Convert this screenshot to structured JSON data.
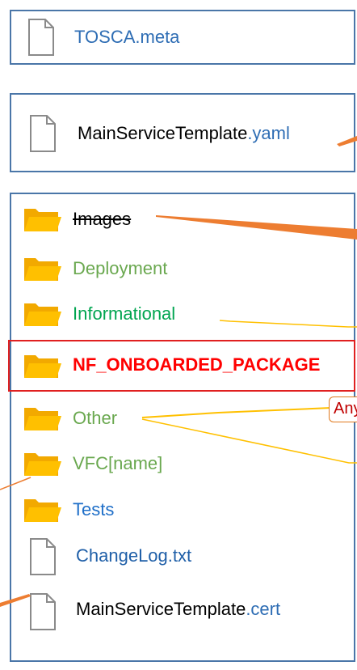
{
  "files_top": {
    "meta": {
      "name": "TOSCA.meta"
    },
    "template": {
      "base": "MainServiceTemplate",
      "ext": ".yaml"
    }
  },
  "folders": [
    {
      "label": "Images",
      "color": "#000000",
      "strikethrough": true
    },
    {
      "label": "Deployment",
      "color": "#6AA84F"
    },
    {
      "label": "Informational",
      "color": "#00A550"
    },
    {
      "label": "NF_ONBOARDED_PACKAGE",
      "color": "#FF0000",
      "highlighted": true
    },
    {
      "label": "Other",
      "color": "#6AA84F"
    },
    {
      "label": "VFC[name]",
      "color": "#6AA84F"
    },
    {
      "label": "Tests",
      "color": "#1F6FC8"
    }
  ],
  "files_bottom": {
    "changelog": {
      "name": "ChangeLog.txt"
    },
    "cert": {
      "base": "MainServiceTemplate",
      "ext": ".cert"
    }
  },
  "callout": {
    "text": "Any u"
  },
  "colors": {
    "box_border": "#4A76A8",
    "folder_yellow": "#FFC000",
    "folder_yellow_dark": "#F2A900",
    "highlight_border": "#E02020",
    "arrow_orange": "#ED7D31",
    "line_yellow": "#FFC000",
    "link_blue": "#2E6DB4"
  },
  "icons": {
    "folder": "folder-icon",
    "file": "file-icon"
  }
}
